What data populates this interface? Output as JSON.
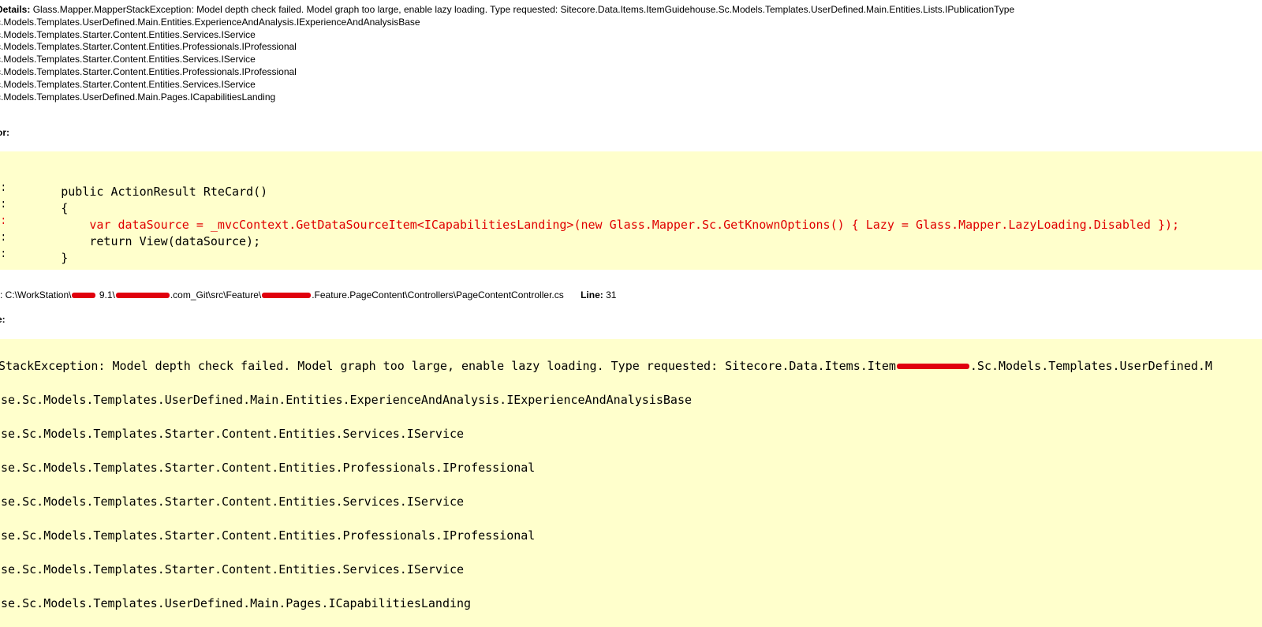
{
  "exception_details": {
    "label": "Details:",
    "message": " Glass.Mapper.MapperStackException: Model depth check failed. Model graph too large, enable lazy loading. Type requested: Sitecore.Data.Items.ItemGuidehouse.Sc.Models.Templates.UserDefined.Main.Entities.Lists.IPublicationType",
    "lines": [
      "c.Models.Templates.UserDefined.Main.Entities.ExperienceAndAnalysis.IExperienceAndAnalysisBase",
      "c.Models.Templates.Starter.Content.Entities.Services.IService",
      "c.Models.Templates.Starter.Content.Entities.Professionals.IProfessional",
      "c.Models.Templates.Starter.Content.Entities.Services.IService",
      "c.Models.Templates.Starter.Content.Entities.Professionals.IProfessional",
      "c.Models.Templates.Starter.Content.Entities.Services.IService",
      "c.Models.Templates.UserDefined.Main.Pages.ICapabilitiesLanding"
    ]
  },
  "source_error": {
    "label": "or:",
    "lines": [
      {
        "num": ":",
        "code": "        public ActionResult RteCard()",
        "error": false
      },
      {
        "num": ":",
        "code": "        {",
        "error": false
      },
      {
        "num": ":",
        "code": "            var dataSource = _mvcContext.GetDataSourceItem<ICapabilitiesLanding>(new Glass.Mapper.Sc.GetKnownOptions() { Lazy = Glass.Mapper.LazyLoading.Disabled });",
        "error": true
      },
      {
        "num": ":",
        "code": "            return View(dataSource);",
        "error": false
      },
      {
        "num": ":",
        "code": "        }",
        "error": false
      }
    ]
  },
  "source_file": {
    "prefix": ": C:\\WorkStation\\",
    "part2": " 9.1\\",
    "part3": ".com_Git\\src\\Feature\\",
    "part4": ".Feature.PageContent\\Controllers\\PageContentController.cs",
    "line_label": "Line:",
    "line_value": " 31"
  },
  "stack_trace": {
    "label": "e:",
    "first_before": "StackException: Model depth check failed. Model graph too large, enable lazy loading. Type requested: Sitecore.Data.Items.Item",
    "first_after": ".Sc.Models.Templates.UserDefined.M",
    "lines": [
      "use.Sc.Models.Templates.UserDefined.Main.Entities.ExperienceAndAnalysis.IExperienceAndAnalysisBase",
      "use.Sc.Models.Templates.Starter.Content.Entities.Services.IService",
      "use.Sc.Models.Templates.Starter.Content.Entities.Professionals.IProfessional",
      "use.Sc.Models.Templates.Starter.Content.Entities.Services.IService",
      "use.Sc.Models.Templates.Starter.Content.Entities.Professionals.IProfessional",
      "use.Sc.Models.Templates.Starter.Content.Entities.Services.IService",
      "use.Sc.Models.Templates.UserDefined.Main.Pages.ICapabilitiesLanding"
    ]
  },
  "colors": {
    "code_background": "#ffffcc",
    "error_text": "#e00000",
    "redaction": "#e0000e"
  }
}
